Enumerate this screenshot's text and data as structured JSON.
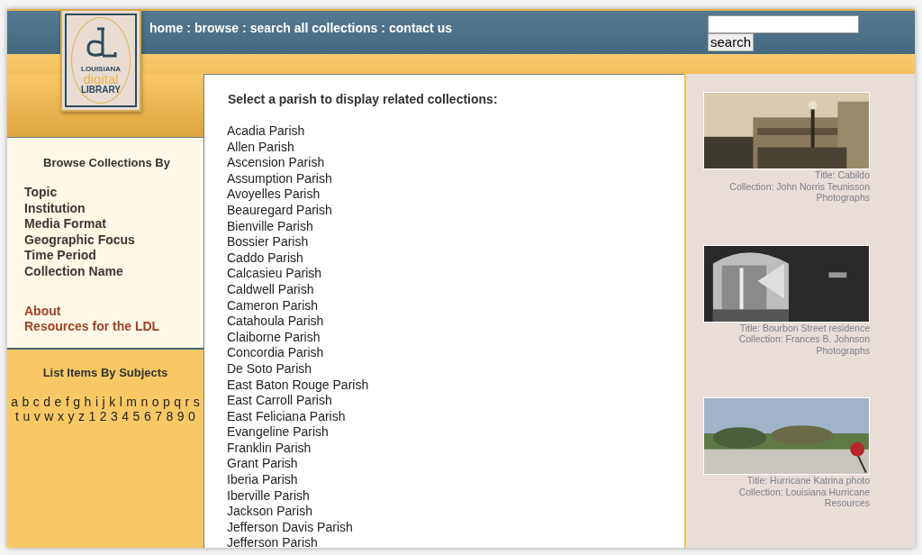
{
  "logo": {
    "top": "LOUISIANA",
    "middle": "digital",
    "bottom": "LIBRARY"
  },
  "nav": {
    "separator": ":",
    "links": [
      "home",
      "browse",
      "search all collections",
      "contact us"
    ]
  },
  "search": {
    "button": "search"
  },
  "sidebar": {
    "heading": "Browse Collections By",
    "browse_links": [
      "Topic",
      "Institution",
      "Media Format",
      "Geographic Focus",
      "Time Period",
      "Collection Name"
    ],
    "info_links": [
      "About",
      "Resources for the LDL"
    ],
    "subjects_heading": "List Items By Subjects",
    "index_rows": [
      [
        "a",
        "b",
        "c",
        "d",
        "e",
        "f",
        "g",
        "h",
        "i",
        "j",
        "k",
        "l",
        "m",
        "n",
        "o",
        "p",
        "q",
        "r",
        "s"
      ],
      [
        "t",
        "u",
        "v",
        "w",
        "x",
        "y",
        "z",
        "1",
        "2",
        "3",
        "4",
        "5",
        "6",
        "7",
        "8",
        "9",
        "0"
      ]
    ]
  },
  "main": {
    "heading": "Select a parish to display related collections:",
    "parishes": [
      "Acadia Parish",
      "Allen Parish",
      "Ascension Parish",
      "Assumption Parish",
      "Avoyelles Parish",
      "Beauregard Parish",
      "Bienville Parish",
      "Bossier Parish",
      "Caddo Parish",
      "Calcasieu Parish",
      "Caldwell Parish",
      "Cameron Parish",
      "Catahoula Parish",
      "Claiborne Parish",
      "Concordia Parish",
      "De Soto Parish",
      "East Baton Rouge Parish",
      "East Carroll Parish",
      "East Feliciana Parish",
      "Evangeline Parish",
      "Franklin Parish",
      "Grant Parish",
      "Iberia Parish",
      "Iberville Parish",
      "Jackson Parish",
      "Jefferson Davis Parish",
      "Jefferson Parish"
    ]
  },
  "featured": [
    {
      "kind": "building",
      "title": "Title: Cabildo",
      "collection": "Collection: John Norris Teunisson Photographs"
    },
    {
      "kind": "courtyard",
      "title": "Title: Bourbon Street residence",
      "collection": "Collection: Frances B. Johnson Photographs"
    },
    {
      "kind": "field",
      "title": "Title: Hurricane Katrina photo",
      "collection": "Collection: Louisiana Hurricane Resources"
    }
  ]
}
